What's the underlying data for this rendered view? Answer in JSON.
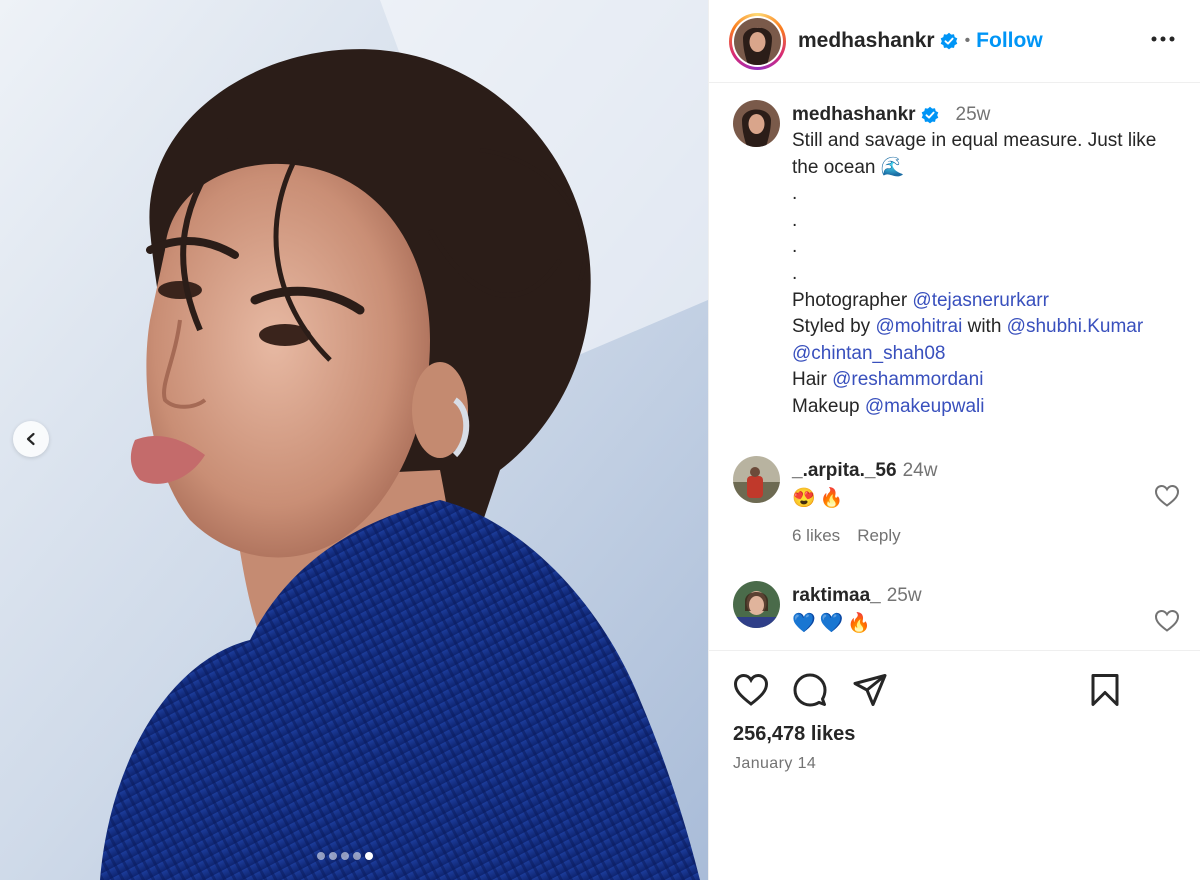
{
  "post": {
    "username": "medhashankr",
    "follow_label": "Follow",
    "separator": "•",
    "carousel": {
      "total_slides": 5,
      "active_slide": 5
    }
  },
  "caption": {
    "username": "medhashankr",
    "time": "25w",
    "lines": [
      {
        "text": "Still and savage in equal measure. Just like"
      },
      {
        "text": "the ocean 🌊"
      },
      {
        "text": "."
      },
      {
        "text": "."
      },
      {
        "text": "."
      },
      {
        "text": "."
      }
    ],
    "credits": [
      {
        "label": "Photographer ",
        "mentions": [
          "@tejasnerurkarr"
        ]
      },
      {
        "label": "Styled by ",
        "mentions": [
          "@mohitrai"
        ],
        "connector": " with ",
        "mentions2": [
          "@shubhi.Kumar"
        ]
      },
      {
        "label": "",
        "mentions": [
          "@chintan_shah08"
        ]
      },
      {
        "label": "Hair ",
        "mentions": [
          "@reshammordani"
        ]
      },
      {
        "label": "Makeup ",
        "mentions": [
          "@makeupwali"
        ]
      }
    ]
  },
  "comments": [
    {
      "username": "_.arpita._56",
      "time": "24w",
      "text": "😍🔥",
      "likes": "6 likes",
      "reply": "Reply"
    },
    {
      "username": "raktimaa_",
      "time": "25w",
      "text": "💙💙🔥"
    }
  ],
  "footer": {
    "likes": "256,478 likes",
    "date": "January 14"
  },
  "colors": {
    "link": "#0095f6",
    "mention": "#3950bd",
    "muted": "#737373",
    "text": "#262626"
  }
}
